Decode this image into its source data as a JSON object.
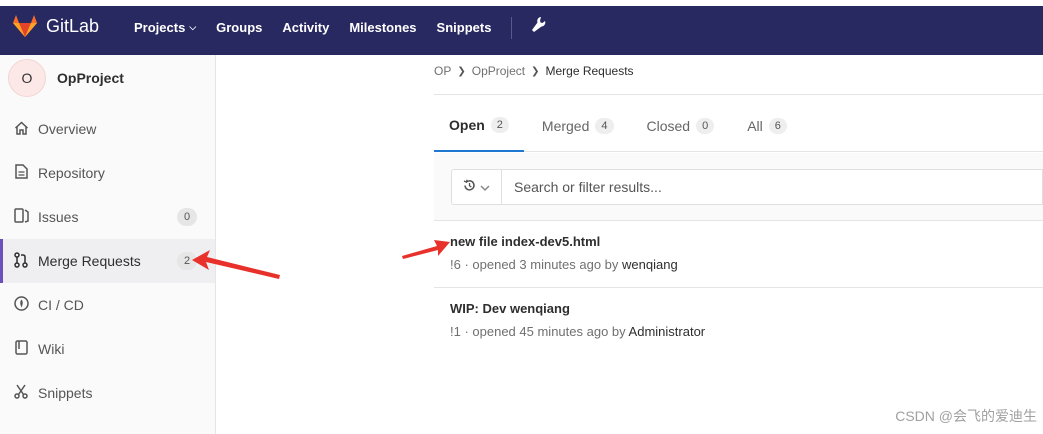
{
  "navbar": {
    "brand": "GitLab",
    "items": [
      {
        "label": "Projects",
        "has_dropdown": true
      },
      {
        "label": "Groups"
      },
      {
        "label": "Activity"
      },
      {
        "label": "Milestones"
      },
      {
        "label": "Snippets"
      }
    ],
    "admin_icon": "wrench-icon"
  },
  "sidebar": {
    "avatar_letter": "O",
    "project_name": "OpProject",
    "items": [
      {
        "label": "Overview",
        "icon": "home-icon"
      },
      {
        "label": "Repository",
        "icon": "document-icon"
      },
      {
        "label": "Issues",
        "icon": "issues-icon",
        "badge": "0"
      },
      {
        "label": "Merge Requests",
        "icon": "merge-request-icon",
        "badge": "2",
        "active": true
      },
      {
        "label": "CI / CD",
        "icon": "rocket-icon"
      },
      {
        "label": "Wiki",
        "icon": "book-icon"
      },
      {
        "label": "Snippets",
        "icon": "scissors-icon"
      }
    ]
  },
  "breadcrumb": [
    "OP",
    "OpProject",
    "Merge Requests"
  ],
  "tabs": [
    {
      "label": "Open",
      "count": "2",
      "active": true
    },
    {
      "label": "Merged",
      "count": "4"
    },
    {
      "label": "Closed",
      "count": "0"
    },
    {
      "label": "All",
      "count": "6"
    }
  ],
  "filter": {
    "placeholder": "Search or filter results..."
  },
  "merge_requests": [
    {
      "title": "new file index-dev5.html",
      "ref": "!6",
      "opened": "· opened 3 minutes ago by",
      "author": "wenqiang"
    },
    {
      "title": "WIP: Dev wenqiang",
      "ref": "!1",
      "opened": "· opened 45 minutes ago by",
      "author": "Administrator"
    }
  ],
  "watermark": "CSDN @会飞的爱迪生",
  "colors": {
    "navbar": "#292961",
    "active_border": "#6b4fbb",
    "tab_underline": "#1f78d1",
    "annotation_arrow": "#e8312b"
  }
}
